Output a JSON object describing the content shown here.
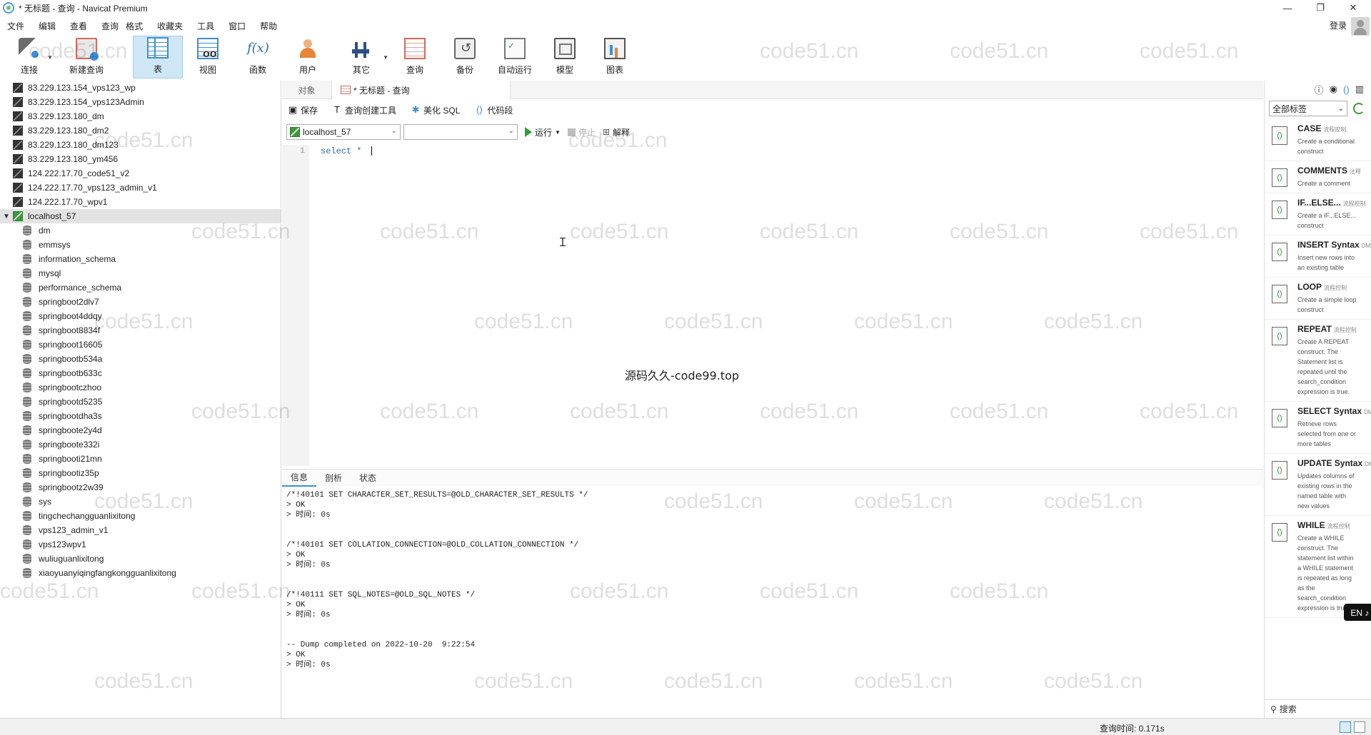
{
  "window": {
    "title": "* 无标题 - 查询 - Navicat Premium",
    "controls": [
      "—",
      "❐",
      "✕"
    ]
  },
  "menu": {
    "items": [
      "文件",
      "编辑",
      "查看",
      "查询",
      "格式",
      "收藏夹",
      "工具",
      "窗口",
      "帮助"
    ],
    "login": "登录"
  },
  "toolbar": {
    "buttons": [
      {
        "label": "连接",
        "icon": "connect-icon"
      },
      {
        "label": "新建查询",
        "icon": "new-query-icon"
      },
      {
        "label": "表",
        "icon": "table-icon",
        "active": true
      },
      {
        "label": "视图",
        "icon": "view-icon"
      },
      {
        "label": "函数",
        "icon": "function-icon"
      },
      {
        "label": "用户",
        "icon": "user-icon"
      },
      {
        "label": "其它",
        "icon": "other-icon"
      },
      {
        "label": "查询",
        "icon": "query-icon"
      },
      {
        "label": "备份",
        "icon": "backup-icon"
      },
      {
        "label": "自动运行",
        "icon": "auto-run-icon"
      },
      {
        "label": "模型",
        "icon": "model-icon"
      },
      {
        "label": "图表",
        "icon": "chart-icon"
      }
    ]
  },
  "tree": {
    "connections_before": [
      "83.229.123.154_vps123_wp",
      "83.229.123.154_vps123Admin",
      "83.229.123.180_dm",
      "83.229.123.180_dm2",
      "83.229.123.180_dm123",
      "83.229.123.180_ym456",
      "124.222.17.70_code51_v2",
      "124.222.17.70_vps123_admin_v1",
      "124.222.17.70_wpv1"
    ],
    "open_connection": "localhost_57",
    "databases": [
      "dm",
      "emmsys",
      "information_schema",
      "mysql",
      "performance_schema",
      "springboot2dlv7",
      "springboot4ddqy",
      "springboot8834f",
      "springboot16605",
      "springbootb534a",
      "springbootb633c",
      "springbootczhoo",
      "springbootd5235",
      "springbootdha3s",
      "springboote2y4d",
      "springboote332i",
      "springbooti21mn",
      "springbootiz35p",
      "springbootz2w39",
      "sys",
      "tingchechangguanlixitong",
      "vps123_admin_v1",
      "vps123wpv1",
      "wuliuguanlixitong",
      "xiaoyuanyiqingfangkongguanlixitong"
    ]
  },
  "tabs": {
    "objects": "对象",
    "query": "* 无标题 - 查询"
  },
  "query_tools": {
    "save": "保存",
    "builder": "查询创建工具",
    "beautify": "美化 SQL",
    "snippet": "代码段"
  },
  "selectors": {
    "connection": "localhost_57",
    "database": "",
    "run": "运行",
    "stop": "停止",
    "explain": "解释"
  },
  "editor": {
    "line": "1",
    "code": "select * "
  },
  "overlay_text": "源码久久-code99.top",
  "result_tabs": [
    "信息",
    "剖析",
    "状态"
  ],
  "log": [
    {
      "sql": "/*!40101 SET CHARACTER_SET_RESULTS=@OLD_CHARACTER_SET_RESULTS */",
      "ok": "> OK",
      "time": "> 时间: 0s"
    },
    {
      "sql": "/*!40101 SET COLLATION_CONNECTION=@OLD_COLLATION_CONNECTION */",
      "ok": "> OK",
      "time": "> 时间: 0s"
    },
    {
      "sql": "/*!40111 SET SQL_NOTES=@OLD_SQL_NOTES */",
      "ok": "> OK",
      "time": "> 时间: 0s"
    },
    {
      "sql": "-- Dump completed on 2022-10-20  9:22:54",
      "ok": "> OK",
      "time": "> 时间: 0s"
    }
  ],
  "right_panel": {
    "filter": "全部标签",
    "snippets": [
      {
        "title": "CASE",
        "tag": "流程控制",
        "desc": "Create a conditional construct"
      },
      {
        "title": "COMMENTS",
        "tag": "注释",
        "desc": "Create a comment"
      },
      {
        "title": "IF...ELSE...",
        "tag": "流程控制",
        "desc": "Create a IF...ELSE... construct"
      },
      {
        "title": "INSERT Syntax",
        "tag": "DML",
        "desc": "Insert new rows into an existing table"
      },
      {
        "title": "LOOP",
        "tag": "流程控制",
        "desc": "Create a simple loop construct"
      },
      {
        "title": "REPEAT",
        "tag": "流程控制",
        "desc": "Create A REPEAT construct. The Statement list is repeated until the search_condition expression is true."
      },
      {
        "title": "SELECT Syntax",
        "tag": "DML",
        "desc": "Retrieve rows selected from one or more tables"
      },
      {
        "title": "UPDATE Syntax",
        "tag": "DML",
        "desc": "Updates columns of existing rows in the named table with new values"
      },
      {
        "title": "WHILE",
        "tag": "流程控制",
        "desc": "Create a WHILE construct. The statement list within a WHILE statement is repeated as long as the search_condition expression is true."
      }
    ],
    "search": "搜索"
  },
  "ime": "EN ♪ 简",
  "status": {
    "query_time": "查询时间: 0.171s"
  },
  "watermark": "code51.cn"
}
